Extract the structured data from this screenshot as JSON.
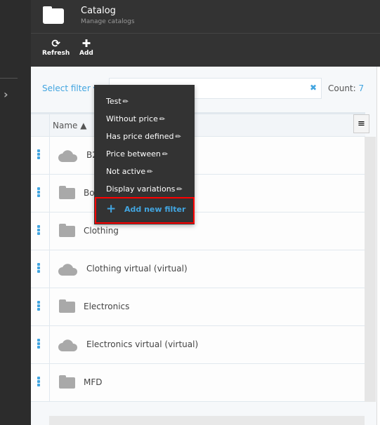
{
  "header": {
    "title": "Catalog",
    "subtitle": "Manage catalogs",
    "icon": "folder-icon"
  },
  "toolbar": {
    "refresh_label": "Refresh",
    "add_label": "Add"
  },
  "filter": {
    "select_label": "Select filter ▾",
    "count_label": "Count:",
    "count_value": "7"
  },
  "table": {
    "column_name": "Name ▲",
    "rows": [
      {
        "name": "B2",
        "icon": "cloud-icon"
      },
      {
        "name": "Bo",
        "icon": "folder-icon"
      },
      {
        "name": "Clothing",
        "icon": "folder-icon"
      },
      {
        "name": "Clothing virtual (virtual)",
        "icon": "cloud-icon"
      },
      {
        "name": "Electronics",
        "icon": "folder-icon"
      },
      {
        "name": "Electronics virtual (virtual)",
        "icon": "cloud-icon"
      },
      {
        "name": "MFD",
        "icon": "folder-icon"
      }
    ]
  },
  "dropdown": {
    "items": [
      "Test",
      "Without price",
      "Has price defined",
      "Price between",
      "Not active",
      "Display variations"
    ],
    "add_label": "Add new filter",
    "highlight_color": "#ff0000"
  },
  "colors": {
    "accent": "#42a5e0",
    "header": "#333333"
  }
}
